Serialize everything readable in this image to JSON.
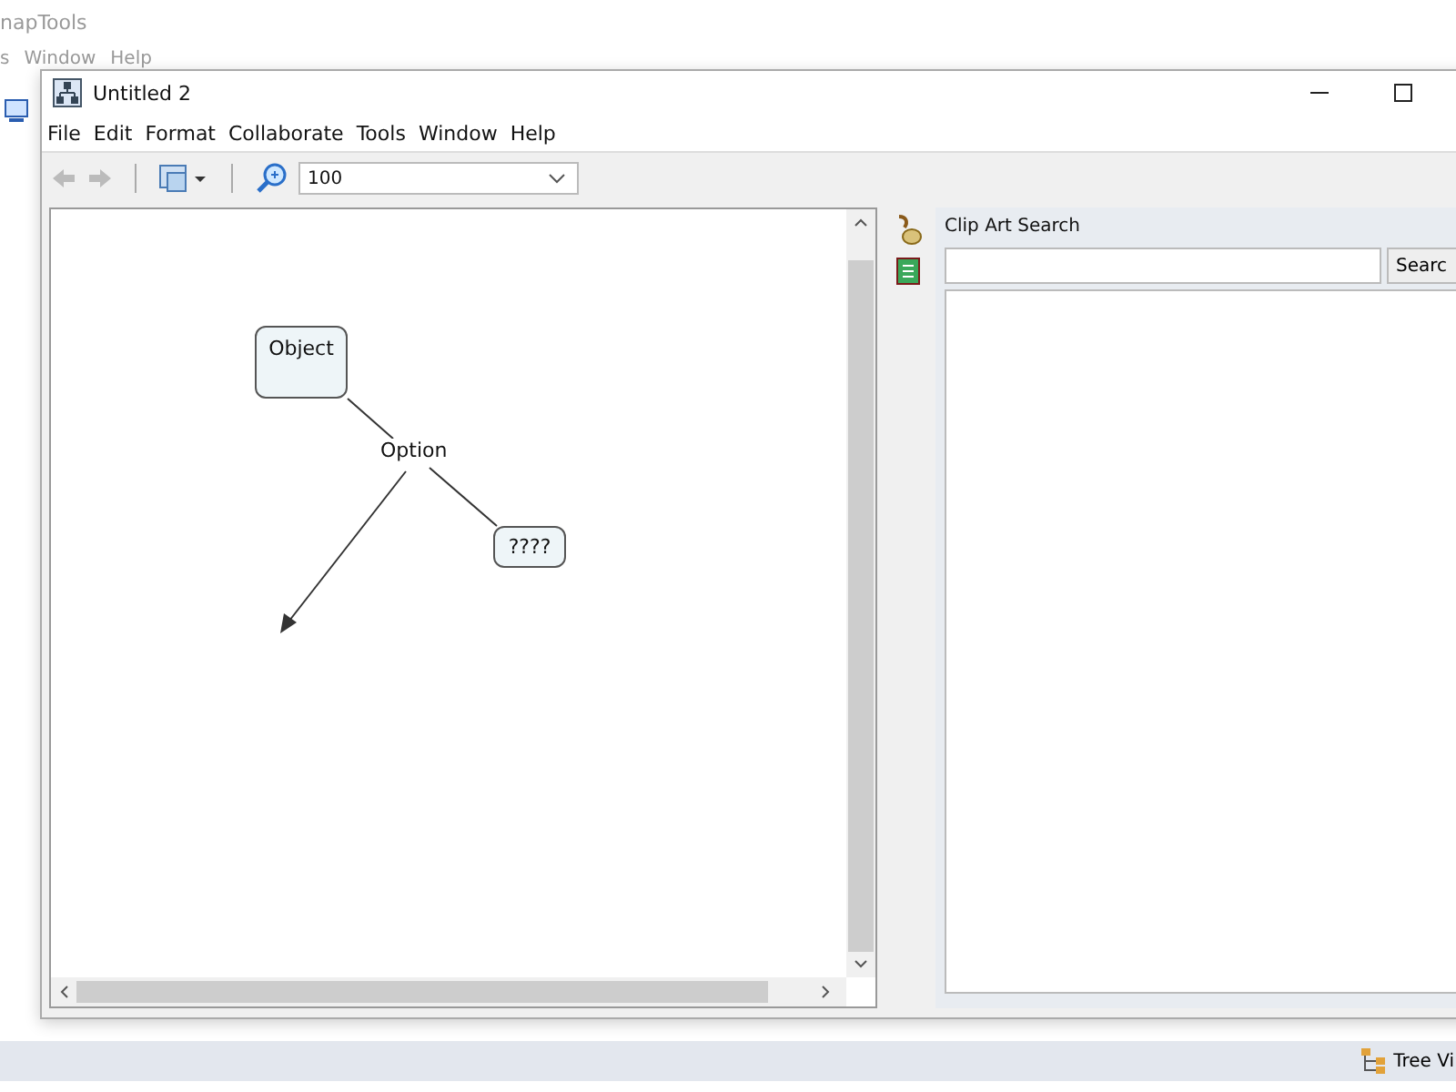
{
  "background_app": {
    "title": "napTools",
    "menu": [
      "s",
      "Window",
      "Help"
    ],
    "status_bar": {
      "tree_view": "Tree Vi"
    }
  },
  "window": {
    "title": "Untitled 2",
    "menu": [
      "File",
      "Edit",
      "Format",
      "Collaborate",
      "Tools",
      "Window",
      "Help"
    ],
    "toolbar": {
      "zoom": "100"
    }
  },
  "diagram": {
    "nodes": [
      {
        "text": "Object"
      },
      {
        "text": "????"
      }
    ],
    "links": [
      {
        "label": "Option"
      }
    ]
  },
  "clip_art": {
    "title": "Clip Art Search",
    "button": "Searc"
  }
}
